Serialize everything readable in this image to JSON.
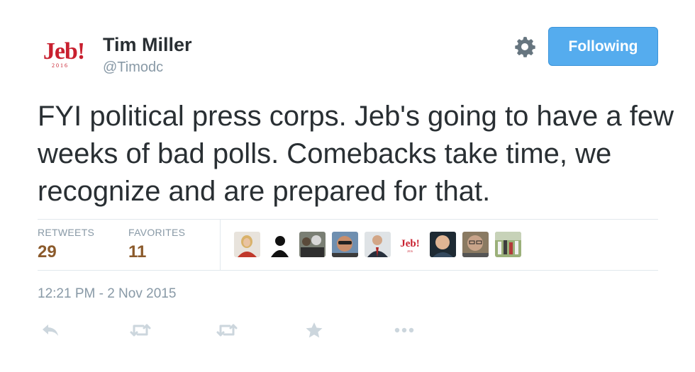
{
  "user": {
    "name": "Tim Miller",
    "handle": "@Timodc",
    "avatar_logo": {
      "word": "Jeb!",
      "year": "2016"
    }
  },
  "follow_button": {
    "label": "Following"
  },
  "tweet": {
    "text": "FYI political press corps. Jeb's going to have a few weeks of bad polls. Comebacks take time, we recognize and are prepared for that.",
    "timestamp": "12:21 PM - 2 Nov 2015"
  },
  "stats": {
    "retweets": {
      "label": "RETWEETS",
      "value": "29"
    },
    "favorites": {
      "label": "FAVORITES",
      "value": "11"
    }
  },
  "favoriter_avatars": [
    {
      "name": "avatar-woman-blonde"
    },
    {
      "name": "avatar-silhouette"
    },
    {
      "name": "avatar-group-photo"
    },
    {
      "name": "avatar-man-sunglasses"
    },
    {
      "name": "avatar-man-suit"
    },
    {
      "name": "avatar-jeb-logo",
      "word": "Jeb!",
      "year": "2016"
    },
    {
      "name": "avatar-man-dark-bg"
    },
    {
      "name": "avatar-woman-glasses"
    },
    {
      "name": "avatar-crowd-photo"
    }
  ],
  "actions": [
    {
      "name": "reply-icon"
    },
    {
      "name": "retweet-icon"
    },
    {
      "name": "retweet-icon-2"
    },
    {
      "name": "favorite-star-icon"
    },
    {
      "name": "more-dots-icon"
    }
  ],
  "colors": {
    "brand_blue": "#55acee",
    "text_primary": "#292f33",
    "text_secondary": "#8899a6",
    "stat_value": "#8b5a2b",
    "jeb_red": "#c8202f"
  }
}
